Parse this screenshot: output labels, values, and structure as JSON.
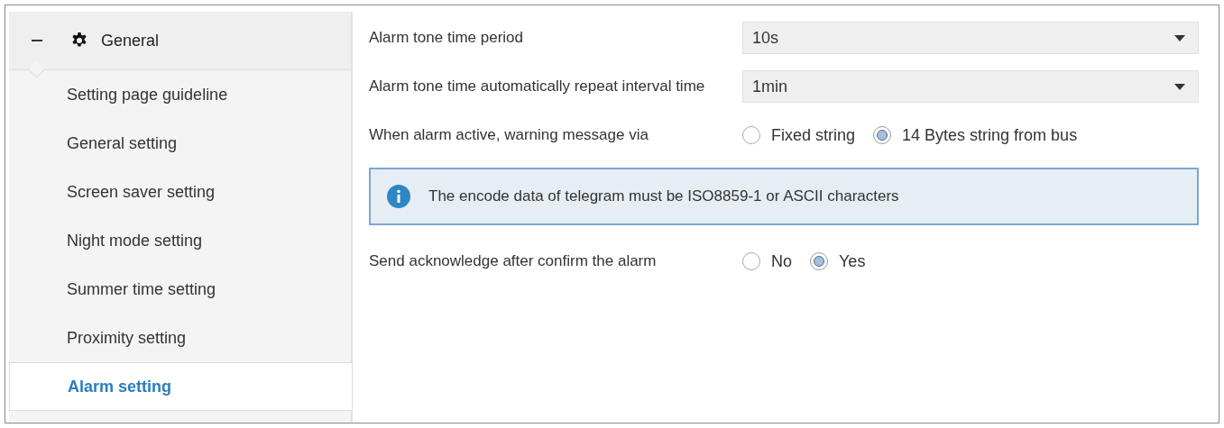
{
  "sidebar": {
    "group": {
      "label": "General",
      "expanded": true,
      "items": [
        {
          "label": "Setting page guideline",
          "selected": false
        },
        {
          "label": "General setting",
          "selected": false
        },
        {
          "label": "Screen saver setting",
          "selected": false
        },
        {
          "label": "Night mode setting",
          "selected": false
        },
        {
          "label": "Summer time setting",
          "selected": false
        },
        {
          "label": "Proximity setting",
          "selected": false
        },
        {
          "label": "Alarm setting",
          "selected": true
        }
      ]
    }
  },
  "settings": [
    {
      "kind": "dropdown",
      "label": "Alarm tone time period",
      "value": "10s"
    },
    {
      "kind": "dropdown",
      "label": "Alarm tone time automatically repeat interval time",
      "value": "1min"
    },
    {
      "kind": "radio",
      "label": "When alarm active, warning message via",
      "options": [
        {
          "label": "Fixed string",
          "selected": false
        },
        {
          "label": "14 Bytes string from bus",
          "selected": true
        }
      ]
    },
    {
      "kind": "info",
      "text": "The encode data of telegram must be ISO8859-1 or ASCII characters"
    },
    {
      "kind": "radio",
      "label": "Send acknowledge after confirm the alarm",
      "options": [
        {
          "label": "No",
          "selected": false
        },
        {
          "label": "Yes",
          "selected": true
        }
      ]
    }
  ]
}
